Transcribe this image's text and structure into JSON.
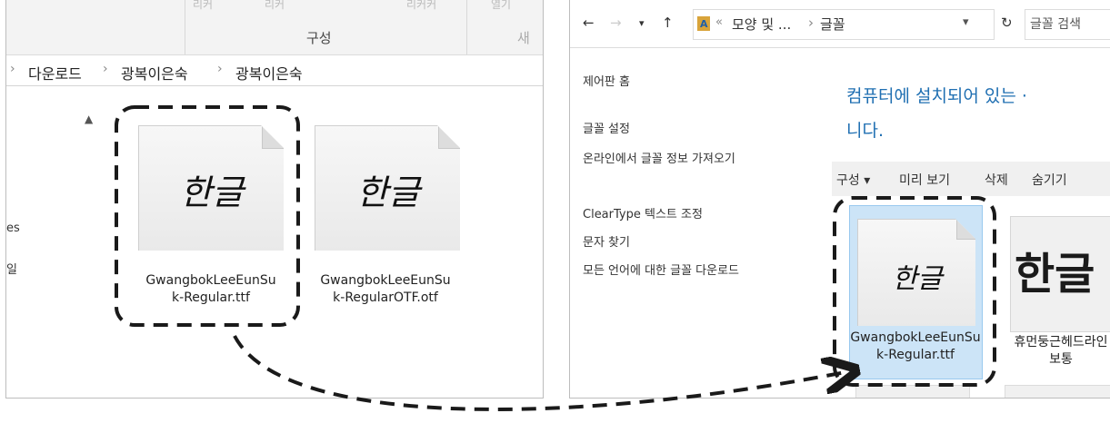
{
  "left_window": {
    "ribbon": {
      "faded_labels": [
        "리커",
        "리커",
        "리커커",
        "열기"
      ],
      "group_label": "구성",
      "partial_label": "새"
    },
    "breadcrumb": [
      "다운로드",
      "광복이은숙",
      "광복이은숙"
    ],
    "nav_items": [
      "es",
      "일"
    ],
    "files": [
      {
        "preview": "한글",
        "name": "GwangbokLeeEunSuk-Regular.ttf"
      },
      {
        "preview": "한글",
        "name": "GwangbokLeeEunSuk-RegularOTF.otf"
      }
    ]
  },
  "right_window": {
    "toolbar": {
      "back": "←",
      "forward": "→",
      "recent": "▾",
      "up": "↑",
      "path_folder": "«",
      "path_part1": "모양 및 ...",
      "path_sep": "›",
      "path_part2": "글꼴",
      "path_dropdown": "▾",
      "refresh": "↻",
      "search_placeholder": "글꼴 검색"
    },
    "sidebar": [
      "제어판 홈",
      "글꼴 설정",
      "온라인에서 글꼴 정보 가져오기",
      "ClearType 텍스트 조정",
      "문자 찾기",
      "모든 언어에 대한 글꼴 다운로드"
    ],
    "headline_line1": "컴퓨터에 설치되어 있는 ·",
    "headline_line2": "니다.",
    "commands": [
      "구성 ▾",
      "미리 보기",
      "삭제",
      "숨기기"
    ],
    "fonts": [
      {
        "preview": "한글",
        "name": "GwangbokLeeEunSuk-Regular.ttf",
        "selected": true
      },
      {
        "preview": "한글",
        "name": "휴먼둥근헤드라인 보통",
        "selected": false
      }
    ]
  },
  "colors": {
    "accent": "#1f6fb2",
    "selection": "#cce4f7",
    "selection_border": "#99c9ef",
    "annotation": "#1a1a1a"
  }
}
